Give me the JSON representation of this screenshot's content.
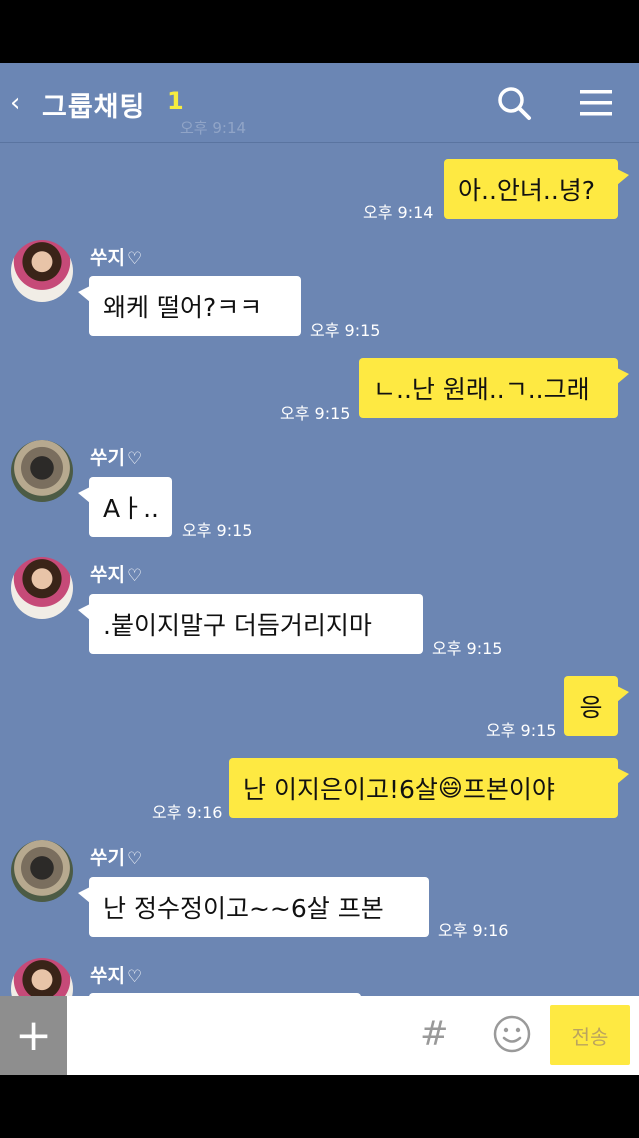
{
  "header": {
    "back_icon": "chevron-left-icon",
    "title": "그룹채팅",
    "member_count": "1",
    "ghost_time": "오후 9:14",
    "search_icon": "search-icon",
    "menu_icon": "hamburger-menu-icon"
  },
  "messages": [
    {
      "from": "me",
      "text": "아..안녀..녕?",
      "time": "오후 9:14"
    },
    {
      "from": "other",
      "sender": "쑤지",
      "text": "왜케 떨어?ㅋㅋ",
      "time": "오후 9:15"
    },
    {
      "from": "me",
      "text": "ㄴ..난 원래..ㄱ..그래",
      "time": "오후 9:15"
    },
    {
      "from": "other",
      "sender": "쑤기",
      "text": "Aㅏ..",
      "time": "오후 9:15"
    },
    {
      "from": "other",
      "sender": "쑤지",
      "text": ".붙이지말구 더듬거리지마",
      "time": "오후 9:15"
    },
    {
      "from": "me",
      "text": "응",
      "time": "오후 9:15"
    },
    {
      "from": "me",
      "text_before": "난 이지은이고!6살",
      "emoji": "😄",
      "text_after": "프본이야",
      "time": "오후 9:16"
    },
    {
      "from": "other",
      "sender": "쑤기",
      "text": "난 정수정이고~~6살 프본",
      "time": "오후 9:16"
    },
    {
      "from": "other",
      "sender": "쑤지",
      "text": "",
      "time": ""
    }
  ],
  "heart": "♡",
  "input": {
    "plus_label": "+",
    "hash_label": "#",
    "send_label": "전송"
  },
  "colors": {
    "background": "#6c86b3",
    "my_bubble": "#fee942",
    "other_bubble": "#ffffff",
    "count_accent": "#f5ec3f"
  }
}
